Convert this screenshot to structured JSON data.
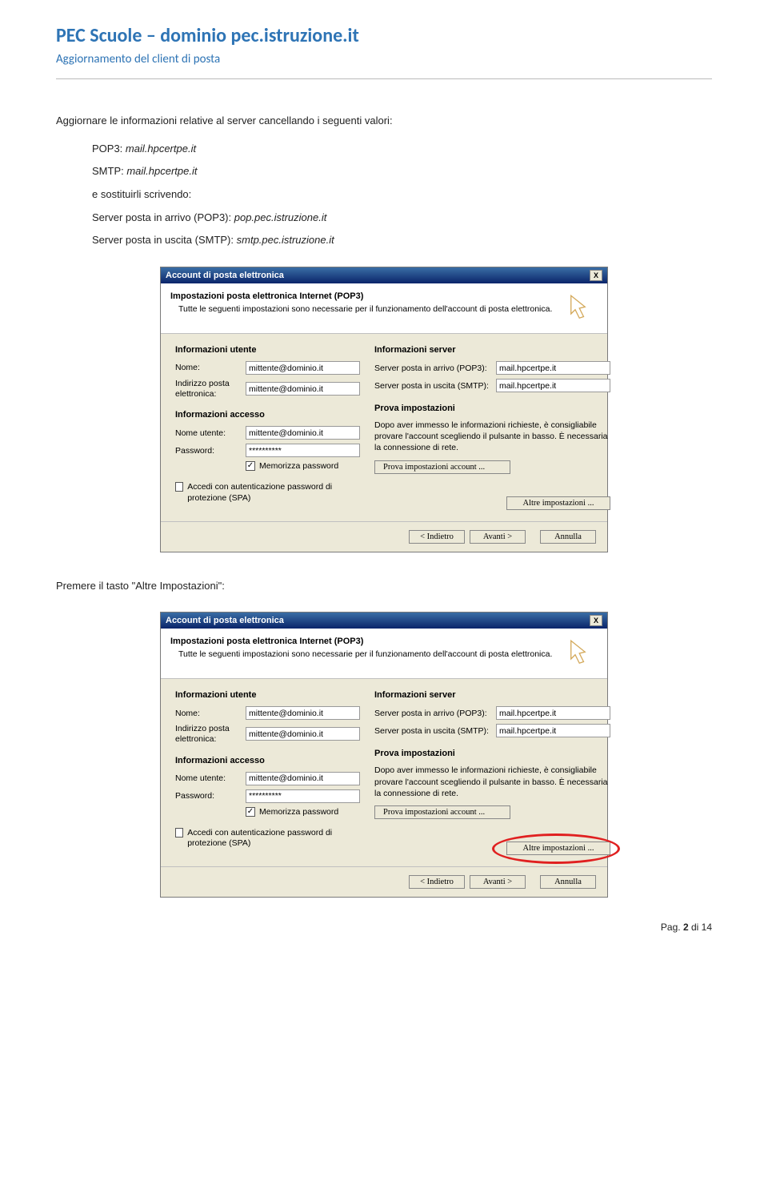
{
  "doc": {
    "title": "PEC Scuole – dominio pec.istruzione.it",
    "subtitle": "Aggiornamento del client di posta",
    "p1": "Aggiornare le informazioni relative al server cancellando i seguenti valori:",
    "pop3_label": "POP3: ",
    "pop3_val": "mail.hpcertpe.it",
    "smtp_label": "SMTP: ",
    "smtp_val": "mail.hpcertpe.it",
    "p2": "e sostituirli scrivendo:",
    "p3a": "Server posta in arrivo (POP3): ",
    "p3b": "pop.pec.istruzione.it",
    "p4a": "Server posta in uscita (SMTP): ",
    "p4b": "smtp.pec.istruzione.it",
    "p5": "Premere il tasto \"Altre Impostazioni\":",
    "pagenum_pre": "Pag. ",
    "pagenum_bold": "2",
    "pagenum_post": " di 14"
  },
  "dlg": {
    "titlebar": "Account di posta elettronica",
    "close_x": "X",
    "hdr_title": "Impostazioni posta elettronica Internet (POP3)",
    "hdr_desc": "Tutte le seguenti impostazioni sono necessarie per il funzionamento dell'account di posta elettronica.",
    "sec_user": "Informazioni utente",
    "lbl_nome": "Nome:",
    "val_nome": "mittente@dominio.it",
    "lbl_email": "Indirizzo posta elettronica:",
    "val_email": "mittente@dominio.it",
    "sec_access": "Informazioni accesso",
    "lbl_user": "Nome utente:",
    "val_user": "mittente@dominio.it",
    "lbl_pw": "Password:",
    "val_pw": "**********",
    "chk_mem": "Memorizza password",
    "chk_spa": "Accedi con autenticazione password di protezione (SPA)",
    "sec_server": "Informazioni server",
    "lbl_pop": "Server posta in arrivo (POP3):",
    "val_pop": "mail.hpcertpe.it",
    "lbl_smtp": "Server posta in uscita (SMTP):",
    "val_smtp": "mail.hpcertpe.it",
    "sec_prova": "Prova impostazioni",
    "prova_desc": "Dopo aver immesso le informazioni richieste, è consigliabile provare l'account scegliendo il pulsante in basso. È necessaria la connessione di rete.",
    "btn_prova": "Prova impostazioni account ...",
    "btn_altre": "Altre impostazioni ...",
    "btn_back": "< Indietro",
    "btn_next": "Avanti >",
    "btn_cancel": "Annulla"
  }
}
